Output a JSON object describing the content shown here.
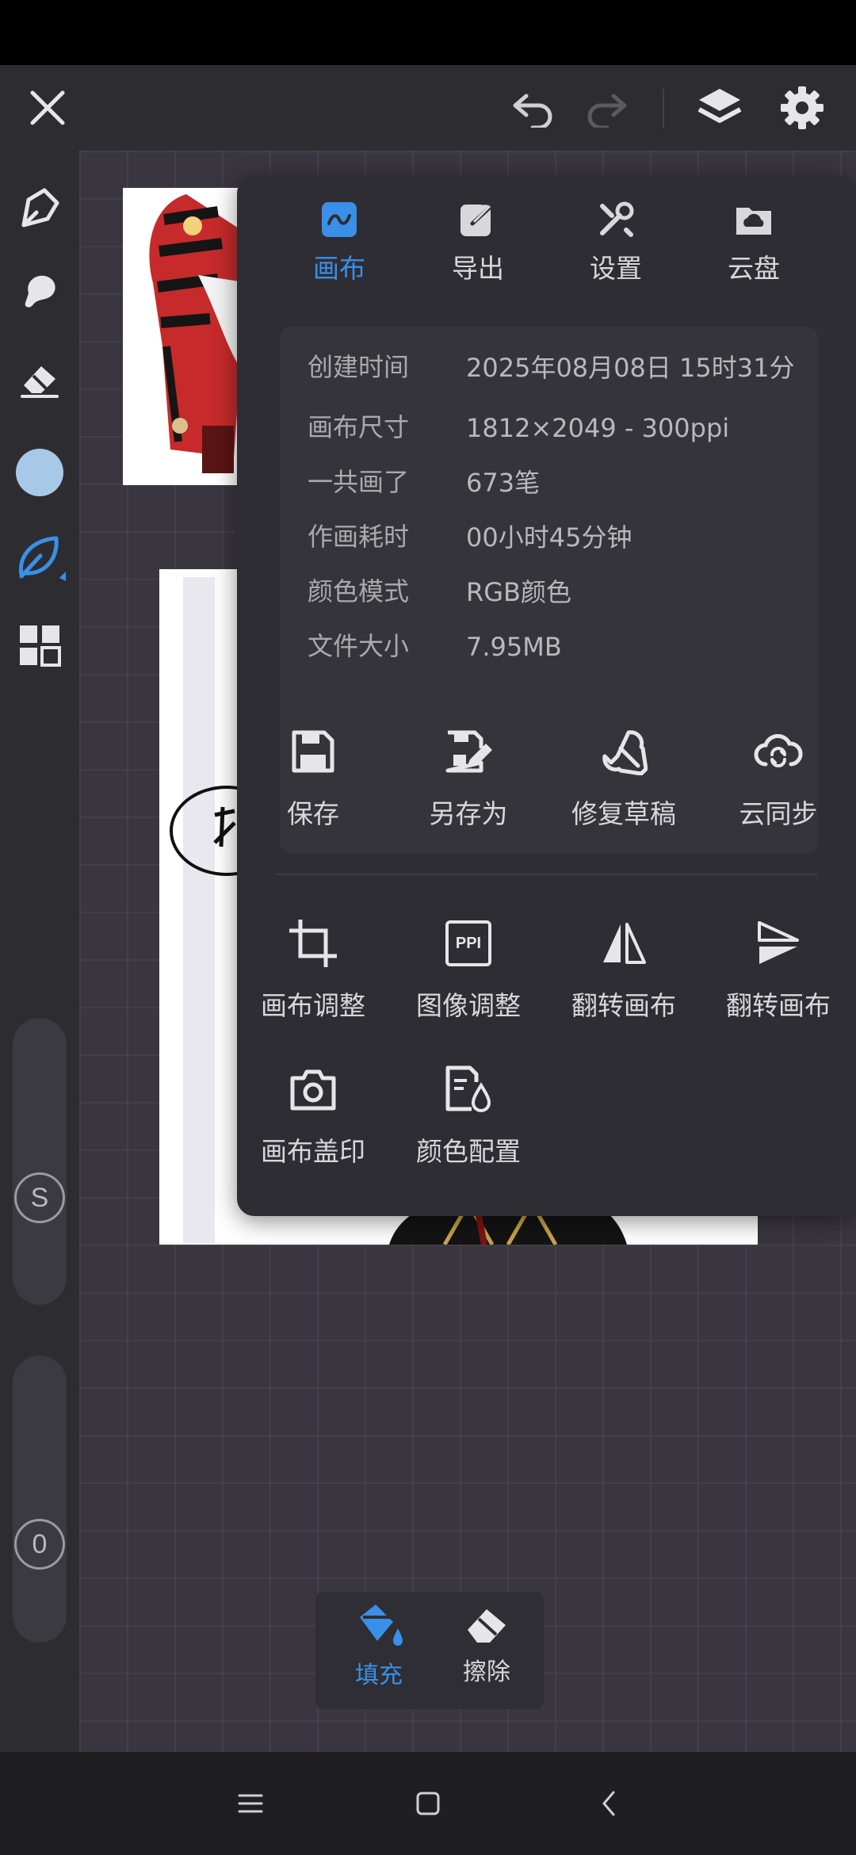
{
  "menu": {
    "tabs": [
      {
        "label": "画布",
        "icon": "canvas-icon",
        "active": true
      },
      {
        "label": "导出",
        "icon": "export-icon",
        "active": false
      },
      {
        "label": "设置",
        "icon": "tools-icon",
        "active": false
      },
      {
        "label": "云盘",
        "icon": "cloud-drive-icon",
        "active": false
      }
    ],
    "info": {
      "created": {
        "key": "创建时间",
        "value": "2025年08月08日 15时31分"
      },
      "size": {
        "key": "画布尺寸",
        "value": "1812×2049 - 300ppi"
      },
      "strokes": {
        "key": "一共画了",
        "value": "673笔"
      },
      "duration": {
        "key": "作画耗时",
        "value": "00小时45分钟"
      },
      "color_mode": {
        "key": "颜色模式",
        "value": "RGB颜色"
      },
      "file_size": {
        "key": "文件大小",
        "value": "7.95MB"
      }
    },
    "actions_row1": [
      {
        "label": "保存",
        "icon": "save-icon"
      },
      {
        "label": "另存为",
        "icon": "save-as-icon"
      },
      {
        "label": "修复草稿",
        "icon": "repair-icon"
      },
      {
        "label": "云同步",
        "icon": "cloud-sync-icon"
      }
    ],
    "actions_row2": [
      {
        "label": "画布调整",
        "icon": "crop-icon"
      },
      {
        "label": "图像调整",
        "icon": "ppi-icon",
        "badge": "PPI"
      },
      {
        "label": "翻转画布",
        "icon": "flip-horizontal-icon"
      },
      {
        "label": "翻转画布",
        "icon": "flip-vertical-icon"
      }
    ],
    "actions_row3": [
      {
        "label": "画布盖印",
        "icon": "camera-icon"
      },
      {
        "label": "颜色配置",
        "icon": "color-config-icon"
      }
    ]
  },
  "sliders": {
    "size_label": "S",
    "opacity_label": "0"
  },
  "fill_erase": {
    "fill_label": "填充",
    "erase_label": "擦除"
  },
  "colors": {
    "accent": "#3a8fe8",
    "current_color": "#a8c8e8",
    "panel_bg": "#2e2d33",
    "toolbar_bg": "#2d2d31"
  }
}
